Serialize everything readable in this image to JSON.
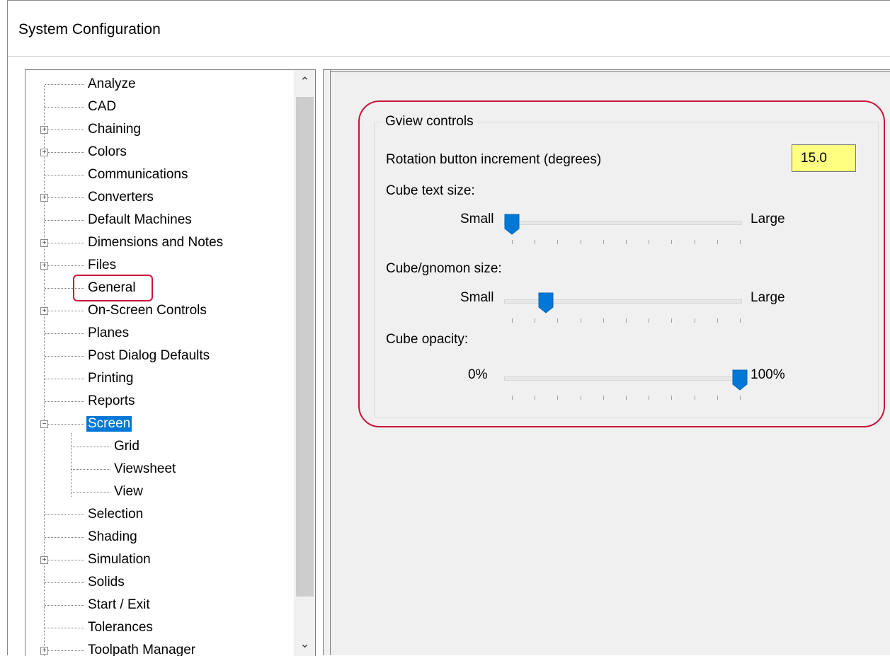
{
  "window": {
    "title": "System Configuration"
  },
  "tree": {
    "items": [
      {
        "label": "Analyze",
        "expandable": false
      },
      {
        "label": "CAD",
        "expandable": false
      },
      {
        "label": "Chaining",
        "expandable": true
      },
      {
        "label": "Colors",
        "expandable": true
      },
      {
        "label": "Communications",
        "expandable": false
      },
      {
        "label": "Converters",
        "expandable": true
      },
      {
        "label": "Default Machines",
        "expandable": false
      },
      {
        "label": "Dimensions and Notes",
        "expandable": true
      },
      {
        "label": "Files",
        "expandable": true
      },
      {
        "label": "General",
        "expandable": false
      },
      {
        "label": "On-Screen Controls",
        "expandable": true
      },
      {
        "label": "Planes",
        "expandable": false
      },
      {
        "label": "Post Dialog Defaults",
        "expandable": false
      },
      {
        "label": "Printing",
        "expandable": false
      },
      {
        "label": "Reports",
        "expandable": false
      },
      {
        "label": "Screen",
        "expandable": true,
        "expanded": true,
        "selected": true
      },
      {
        "label": "Grid",
        "child": true
      },
      {
        "label": "Viewsheet",
        "child": true
      },
      {
        "label": "View",
        "child": true
      },
      {
        "label": "Selection",
        "expandable": false
      },
      {
        "label": "Shading",
        "expandable": false
      },
      {
        "label": "Simulation",
        "expandable": true
      },
      {
        "label": "Solids",
        "expandable": false
      },
      {
        "label": "Start / Exit",
        "expandable": false
      },
      {
        "label": "Tolerances",
        "expandable": false
      },
      {
        "label": "Toolpath Manager",
        "expandable": true
      }
    ]
  },
  "gview": {
    "group_title": "Gview controls",
    "rotation_label": "Rotation button increment (degrees)",
    "rotation_value": "15.0",
    "cube_text_size": {
      "label": "Cube text size:",
      "min_label": "Small",
      "max_label": "Large",
      "position": 0.0
    },
    "cube_gnomon_size": {
      "label": "Cube/gnomon size:",
      "min_label": "Small",
      "max_label": "Large",
      "position": 0.15
    },
    "cube_opacity": {
      "label": "Cube opacity:",
      "min_label": "0%",
      "max_label": "100%",
      "position": 1.0
    }
  },
  "colors": {
    "selection": "#0078d7",
    "slider_thumb": "#0078d7",
    "annotation": "#c8143c",
    "input_highlight": "#ffff80"
  }
}
